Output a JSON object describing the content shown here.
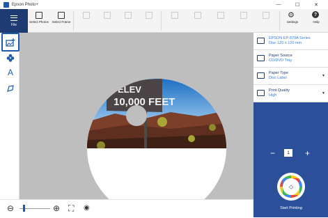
{
  "window": {
    "title": "Epson Photo+",
    "minimize": "—",
    "maximize": "☐",
    "close": "✕"
  },
  "toolbar": {
    "file": "File",
    "select_photos": "Select Photos",
    "select_frame": "Select Frame",
    "settings": "Settings",
    "help": "Help"
  },
  "photo": {
    "sign_line1": "ELEV",
    "sign_line2": "10,000 FEET"
  },
  "panel": {
    "printer_name": "EPSON EP-879A Series",
    "printer_detail": "Disc 120 x 120 mm",
    "paper_source_label": "Paper Source",
    "paper_source_value": "CD/DVD Tray",
    "paper_type_label": "Paper Type",
    "paper_type_value": "Disc Label",
    "print_quality_label": "Print Quality",
    "print_quality_value": "High",
    "copies": "1",
    "minus": "−",
    "plus": "+",
    "start_printing": "Start Printing"
  },
  "colors": {
    "brand_blue": "#1f3b73",
    "panel_blue": "#2b4f98",
    "accent_blue": "#3a7dd8",
    "canvas_gray": "#bebebe"
  }
}
